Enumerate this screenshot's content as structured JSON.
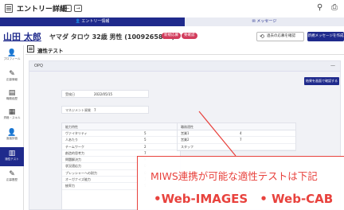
{
  "window": {
    "title": "エントリー詳細",
    "back_glyph": "←",
    "forward_glyph": "→",
    "pin_glyph": "⚲",
    "print_glyph": "⎙"
  },
  "tabs": {
    "entry": "👤 エントリー情報",
    "message": "✉ メッセージ"
  },
  "header": {
    "name": "山田 太郎",
    "details": "ヤマダ タロウ 32歳 男性 (1009265839)",
    "badge1": "新規応募",
    "badge2": "要確認",
    "btn_history": "過去の応募を確認",
    "btn_history_icon": "⟲",
    "btn_message": "新規メッセージを作成"
  },
  "sidebar": {
    "items": [
      {
        "icon": "👤",
        "label": "プロフィール"
      },
      {
        "icon": "✎",
        "label": "応募情報"
      },
      {
        "icon": "▤",
        "label": "職務経歴"
      },
      {
        "icon": "▦",
        "label": "資格・スキル"
      },
      {
        "icon": "👤",
        "label": "面接評価"
      },
      {
        "icon": "▥",
        "label": "適性テスト"
      },
      {
        "icon": "✎",
        "label": "応募履歴"
      }
    ]
  },
  "section": {
    "title": "適性テスト"
  },
  "opq": {
    "title": "OPQ",
    "toggle": "—",
    "report_button": "結果を画面で確認する",
    "exam_date_label": "受検日",
    "exam_date": "2022/05/15",
    "management_label": "マネジメント資質",
    "management_value": "7",
    "ability_header": "能力特性",
    "ability_rows": [
      {
        "label": "ヴァイタリティ",
        "value": "5"
      },
      {
        "label": "人あたり",
        "value": "5"
      },
      {
        "label": "チームワーク",
        "value": "2"
      },
      {
        "label": "創造的思考力",
        "value": "7"
      },
      {
        "label": "問題解決力",
        "value": "9"
      },
      {
        "label": "状況適応力",
        "value": "6"
      },
      {
        "label": "プレッシャーへの耐力",
        "value": "6"
      },
      {
        "label": "オーガナイズ能力",
        "value": "7"
      },
      {
        "label": "統率力",
        "value": "5"
      }
    ],
    "job_header": "職務適性",
    "job_rows": [
      {
        "label": "営業1",
        "value": "4"
      },
      {
        "label": "営業2",
        "value": "7"
      },
      {
        "label": "スタッフ",
        "value": ""
      }
    ]
  },
  "callout": {
    "line1": "MIWS連携が可能な適性テストは下記",
    "line2": "•Web-IMAGES　• Web-CAB"
  }
}
